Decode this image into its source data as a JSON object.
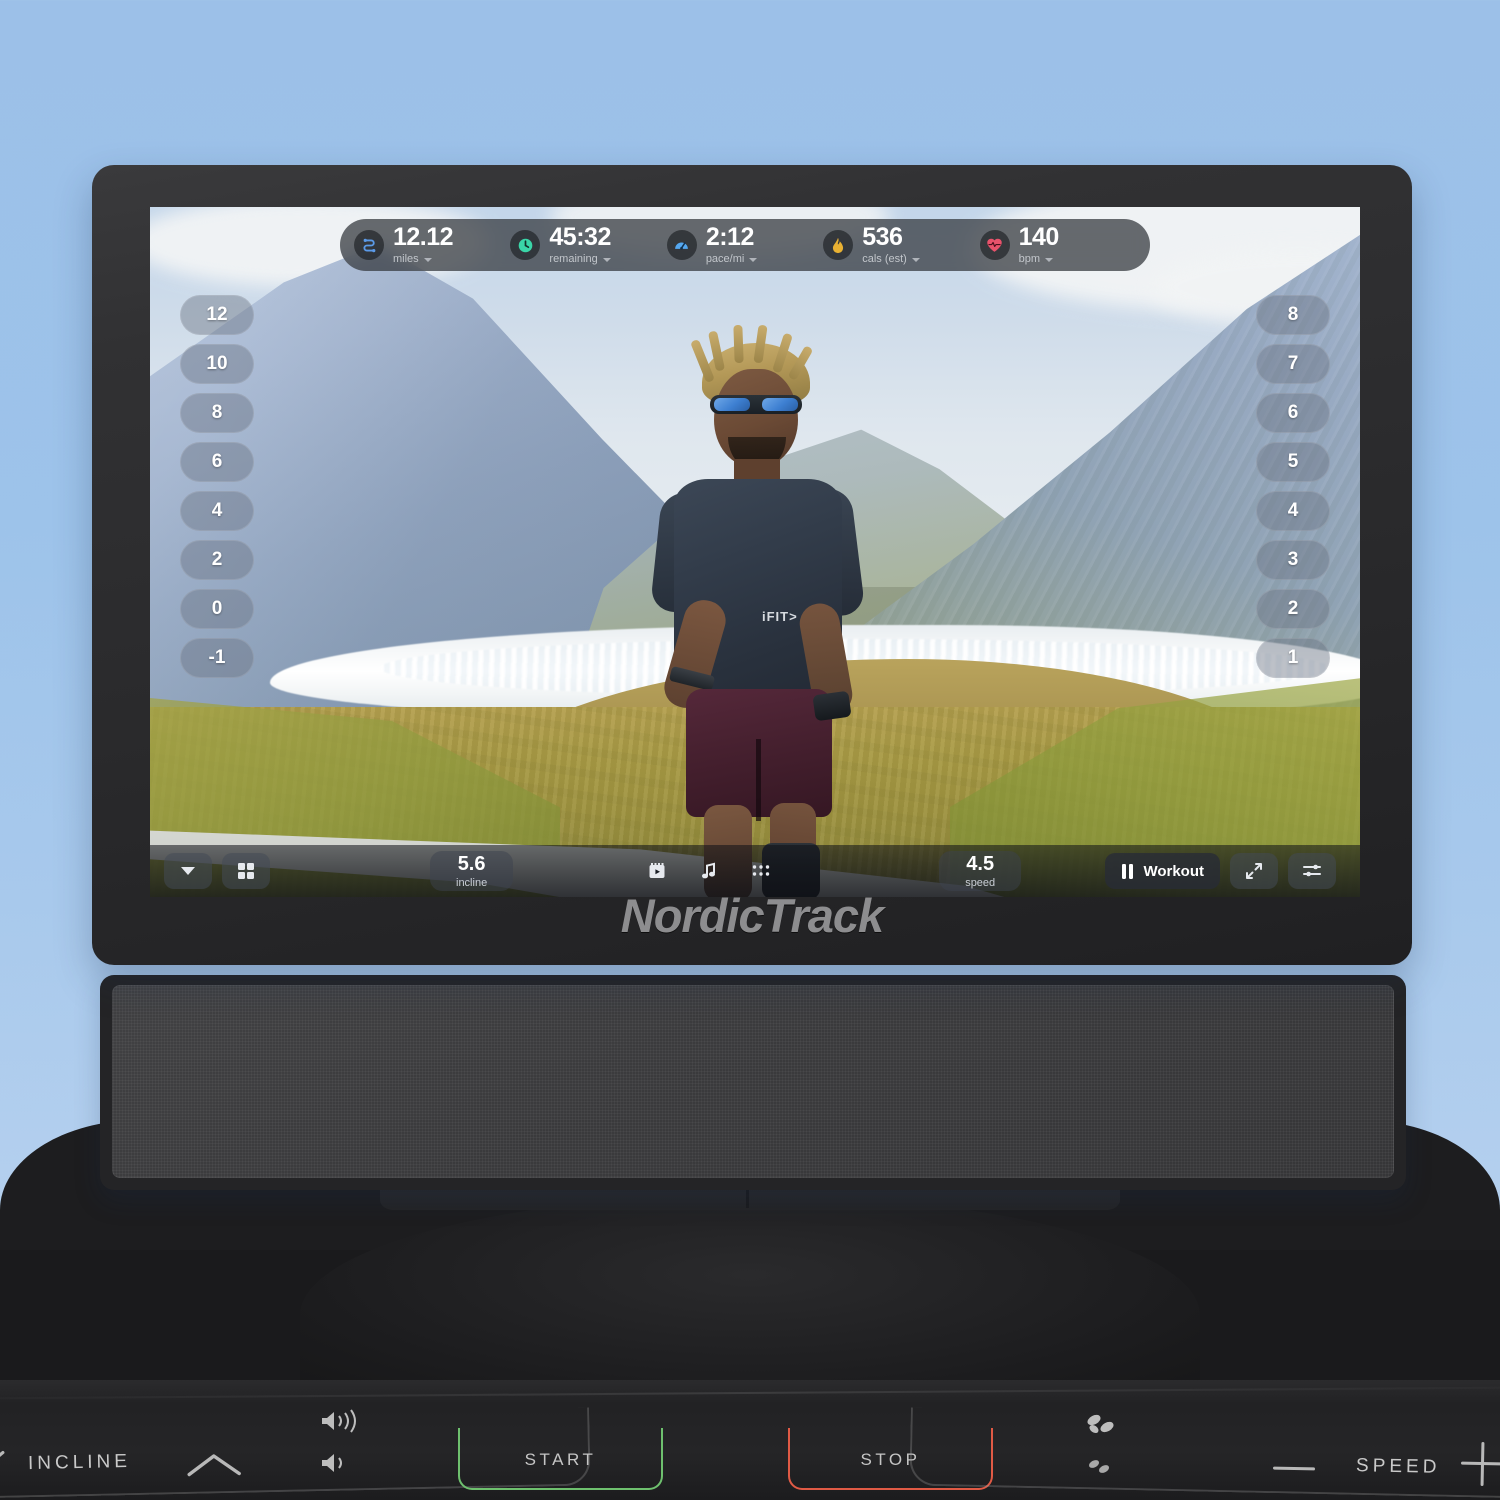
{
  "device": {
    "brand": "NordicTrack"
  },
  "workout_overlay": {
    "metrics": [
      {
        "value": "12.12",
        "label": "miles",
        "icon": "route-icon",
        "icon_color": "#5b9ae8"
      },
      {
        "value": "45:32",
        "label": "remaining",
        "icon": "clock-icon",
        "icon_color": "#3ad6a8"
      },
      {
        "value": "2:12",
        "label": "pace/mi",
        "icon": "speedometer-icon",
        "icon_color": "#55a8f0"
      },
      {
        "value": "536",
        "label": "cals (est)",
        "icon": "flame-icon",
        "icon_color": "#e8b133"
      },
      {
        "value": "140",
        "label": "bpm",
        "icon": "heart-icon",
        "icon_color": "#e8526b"
      }
    ],
    "incline_scale": [
      "12",
      "10",
      "8",
      "6",
      "4",
      "2",
      "0",
      "-1"
    ],
    "speed_scale": [
      "8",
      "7",
      "6",
      "5",
      "4",
      "3",
      "2",
      "1"
    ],
    "bottom_bar": {
      "collapse_icon": "chevron-down-icon",
      "grid_icon": "grid-2x2-icon",
      "incline": {
        "value": "5.6",
        "label": "incline"
      },
      "video_icon": "video-camera-icon",
      "music_icon": "music-note-icon",
      "apps_icon": "apps-grid-icon",
      "speed": {
        "value": "4.5",
        "label": "speed"
      },
      "workout_label": "Workout",
      "pause_icon": "pause-icon",
      "fullscreen_icon": "expand-arrows-icon",
      "settings_icon": "sliders-icon"
    },
    "shirt_brand": "iFIT>"
  },
  "console": {
    "incline_label": "INCLINE",
    "incline_up_icon": "chevron-up-icon",
    "incline_down_icon": "chevron-down-icon",
    "volume_up_icon": "volume-high-icon",
    "volume_down_icon": "volume-low-icon",
    "start_label": "START",
    "stop_label": "STOP",
    "fan_high_icon": "fan-high-icon",
    "fan_low_icon": "fan-low-icon",
    "speed_label": "SPEED",
    "speed_minus_icon": "minus-icon",
    "speed_plus_icon": "plus-icon",
    "colors": {
      "start": "#6ec06e",
      "stop": "#e05a45"
    }
  }
}
